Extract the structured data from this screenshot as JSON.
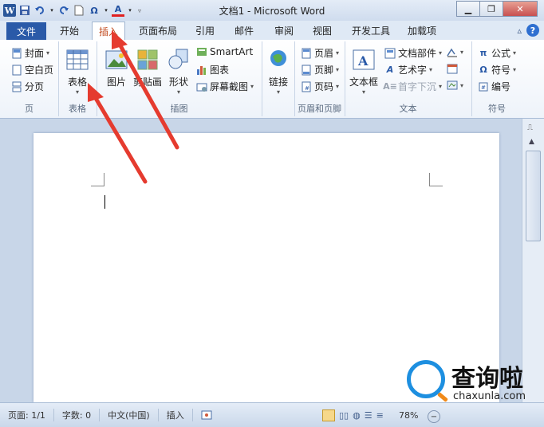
{
  "window": {
    "title": "文档1 - Microsoft Word"
  },
  "quick_access": {
    "icons": [
      "word-icon",
      "save-icon",
      "undo-icon",
      "redo-icon",
      "new-doc-icon",
      "omega-icon",
      "font-color-icon",
      "customize-icon"
    ]
  },
  "tabs": {
    "file": "文件",
    "items": [
      "开始",
      "插入",
      "页面布局",
      "引用",
      "邮件",
      "审阅",
      "视图",
      "开发工具",
      "加载项"
    ],
    "active": "插入"
  },
  "ribbon": {
    "pages": {
      "label": "页",
      "cover": "封面",
      "blank": "空白页",
      "break": "分页"
    },
    "tables": {
      "label": "表格",
      "table": "表格"
    },
    "illustrations": {
      "label": "插图",
      "picture": "图片",
      "clipart": "剪贴画",
      "shapes": "形状",
      "smartart": "SmartArt",
      "chart": "图表",
      "screenshot": "屏幕截图"
    },
    "links": {
      "label": "链接"
    },
    "header_footer": {
      "label": "页眉和页脚",
      "header": "页眉",
      "footer": "页脚",
      "page_number": "页码"
    },
    "text": {
      "label": "文本",
      "textbox": "文本框",
      "quickparts": "文档部件",
      "wordart": "艺术字",
      "dropcap": "首字下沉"
    },
    "symbols": {
      "label": "符号",
      "equation": "公式",
      "symbol": "符号",
      "number": "编号"
    }
  },
  "status": {
    "page": "页面: 1/1",
    "words": "字数: 0",
    "language": "中文(中国)",
    "mode": "插入",
    "zoom": "78%"
  },
  "watermark": {
    "text": "查询啦",
    "url": "chaxunla.com"
  },
  "colors": {
    "accent": "#2a5aa8",
    "arrow": "#e53b2f",
    "active_tab_text": "#c24a1d"
  }
}
